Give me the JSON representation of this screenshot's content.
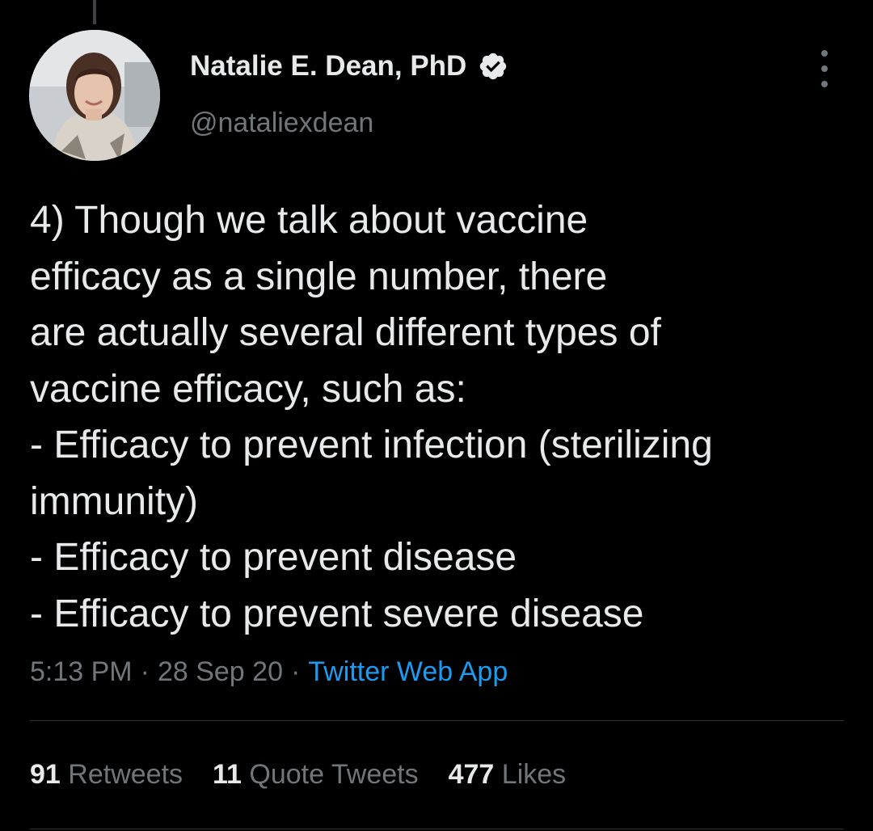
{
  "tweet": {
    "author": {
      "name": "Natalie E. Dean, PhD",
      "handle": "@nataliexdean",
      "verified": true
    },
    "text_lines": [
      "4) Though we talk about vaccine",
      "efficacy as a single number, there",
      "are actually several different types of",
      "vaccine efficacy, such as:",
      "- Efficacy to prevent infection (sterilizing",
      "immunity)",
      "- Efficacy to prevent disease",
      "- Efficacy to prevent severe disease"
    ],
    "time": "5:13 PM",
    "date": "28 Sep 20",
    "separator": "·",
    "source": "Twitter Web App",
    "stats": {
      "retweets": {
        "count": "91",
        "label": "Retweets"
      },
      "quote_tweets": {
        "count": "11",
        "label": "Quote Tweets"
      },
      "likes": {
        "count": "477",
        "label": "Likes"
      }
    }
  },
  "icons": {
    "verified": "verified-badge-icon",
    "more": "more-vertical-icon"
  },
  "colors": {
    "background": "#000000",
    "text": "#e7e9ea",
    "secondary_text": "#71767b",
    "link": "#1d9bf0",
    "divider": "#2f3336"
  }
}
